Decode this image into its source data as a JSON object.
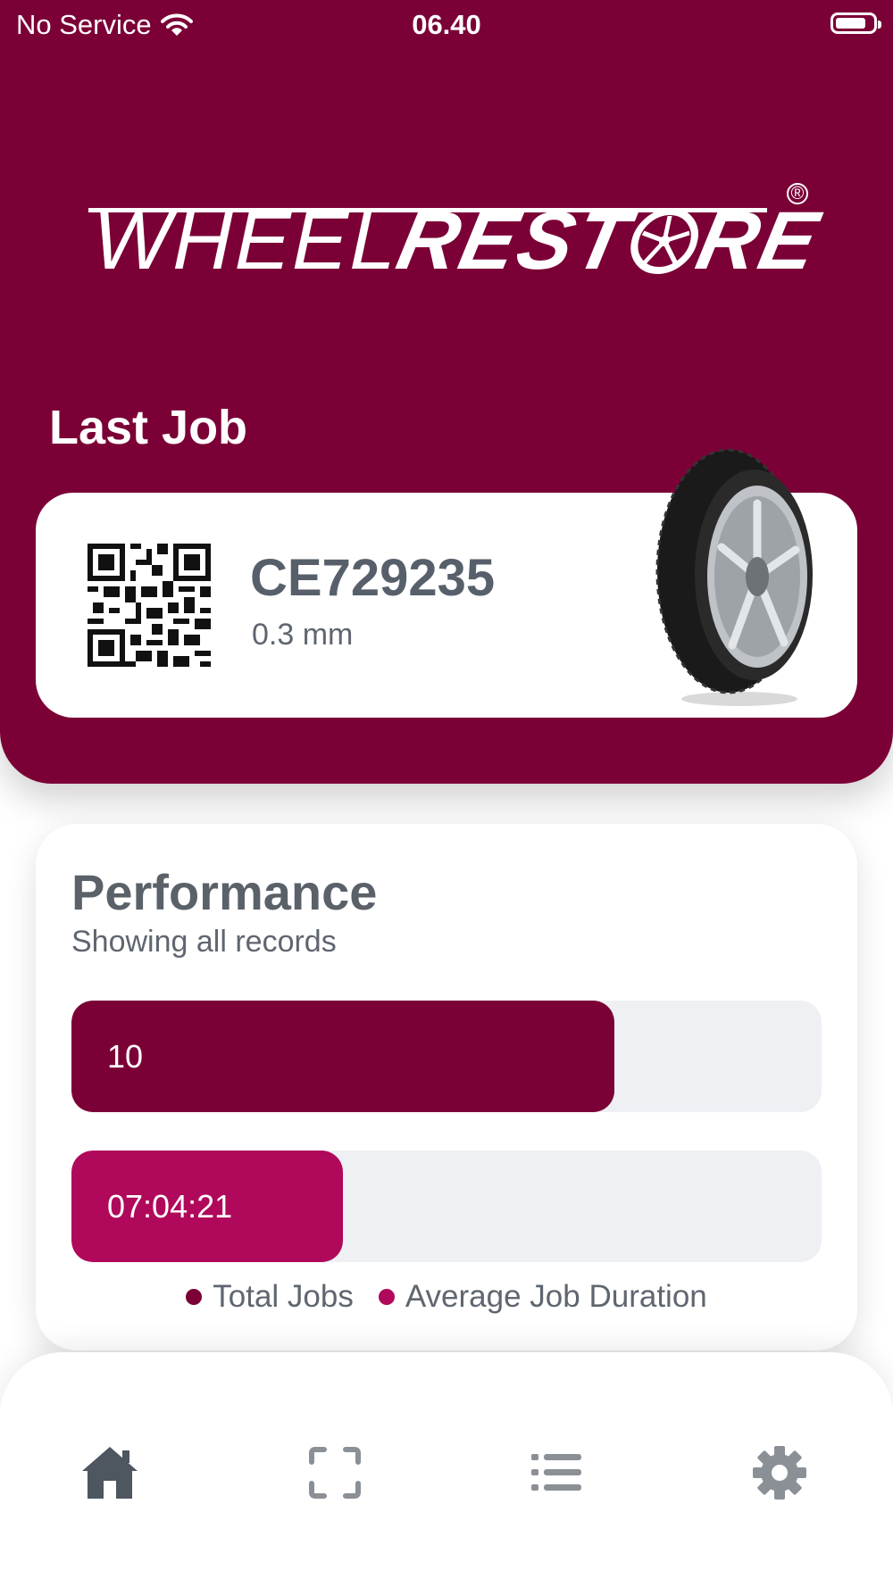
{
  "status_bar": {
    "carrier": "No Service",
    "time": "06.40"
  },
  "logo": {
    "text_light": "WHEEL",
    "text_bold_1": "REST",
    "text_bold_2": "RE",
    "registered": "®"
  },
  "last_job": {
    "title": "Last Job",
    "job_id": "CE729235",
    "depth": "0.3 mm"
  },
  "performance": {
    "title": "Performance",
    "subtitle": "Showing all records",
    "bars": [
      {
        "value_label": "10",
        "fill_fraction": 0.724,
        "color": "#7b0036"
      },
      {
        "value_label": "07:04:21",
        "fill_fraction": 0.362,
        "color": "#b0085a"
      }
    ],
    "legend": [
      {
        "label": "Total Jobs",
        "color": "#7b0036"
      },
      {
        "label": "Average Job Duration",
        "color": "#b0085a"
      }
    ]
  },
  "nav": {
    "items": [
      "home-icon",
      "scan-icon",
      "list-icon",
      "gear-icon"
    ]
  },
  "colors": {
    "brand": "#7b0036",
    "accent": "#b0085a",
    "text_gray": "#57606a",
    "track": "#eff0f4"
  }
}
